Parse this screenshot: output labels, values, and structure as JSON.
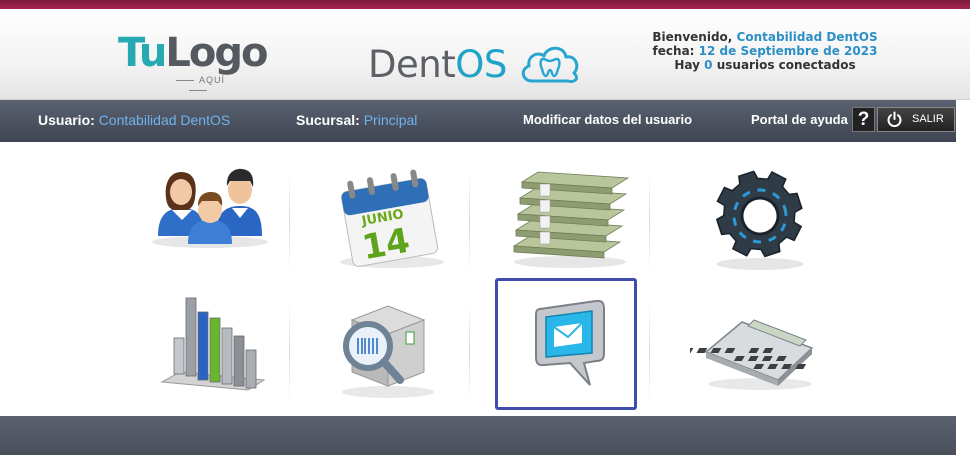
{
  "colors": {
    "accent": "#2c8fc6",
    "nav_bg": "#4a505b",
    "selected_border": "#3f4dae",
    "top_strip": "#8f1f47"
  },
  "logo": {
    "tu": "Tu",
    "logo": "Logo",
    "aqui": "AQUÍ"
  },
  "brand": {
    "dent": "Dent",
    "os": "OS",
    "icon": "cloud-tooth-icon"
  },
  "welcome": {
    "greeting_prefix": "Bienvenido,",
    "user": "Contabilidad DentOS",
    "date_prefix": "fecha:",
    "date": "12 de Septiembre de 2023",
    "users_prefix": "Hay",
    "users_count": "0",
    "users_suffix": "usuarios conectados"
  },
  "navbar": {
    "user_label": "Usuario:",
    "user_value": "Contabilidad DentOS",
    "branch_label": "Sucursal:",
    "branch_value": "Principal",
    "modify_link": "Modificar datos del usuario",
    "help_link": "Portal de ayuda",
    "help_button": "?",
    "logout_button": "SALIR"
  },
  "modules": [
    {
      "icon": "users-icon"
    },
    {
      "icon": "calendar-icon",
      "calendar_month": "JUNIO",
      "calendar_day": "14"
    },
    {
      "icon": "money-stack-icon"
    },
    {
      "icon": "settings-gear-icon"
    },
    {
      "icon": "bar-chart-icon"
    },
    {
      "icon": "inventory-search-icon"
    },
    {
      "icon": "message-icon",
      "selected": true
    },
    {
      "icon": "calculator-icon"
    }
  ]
}
